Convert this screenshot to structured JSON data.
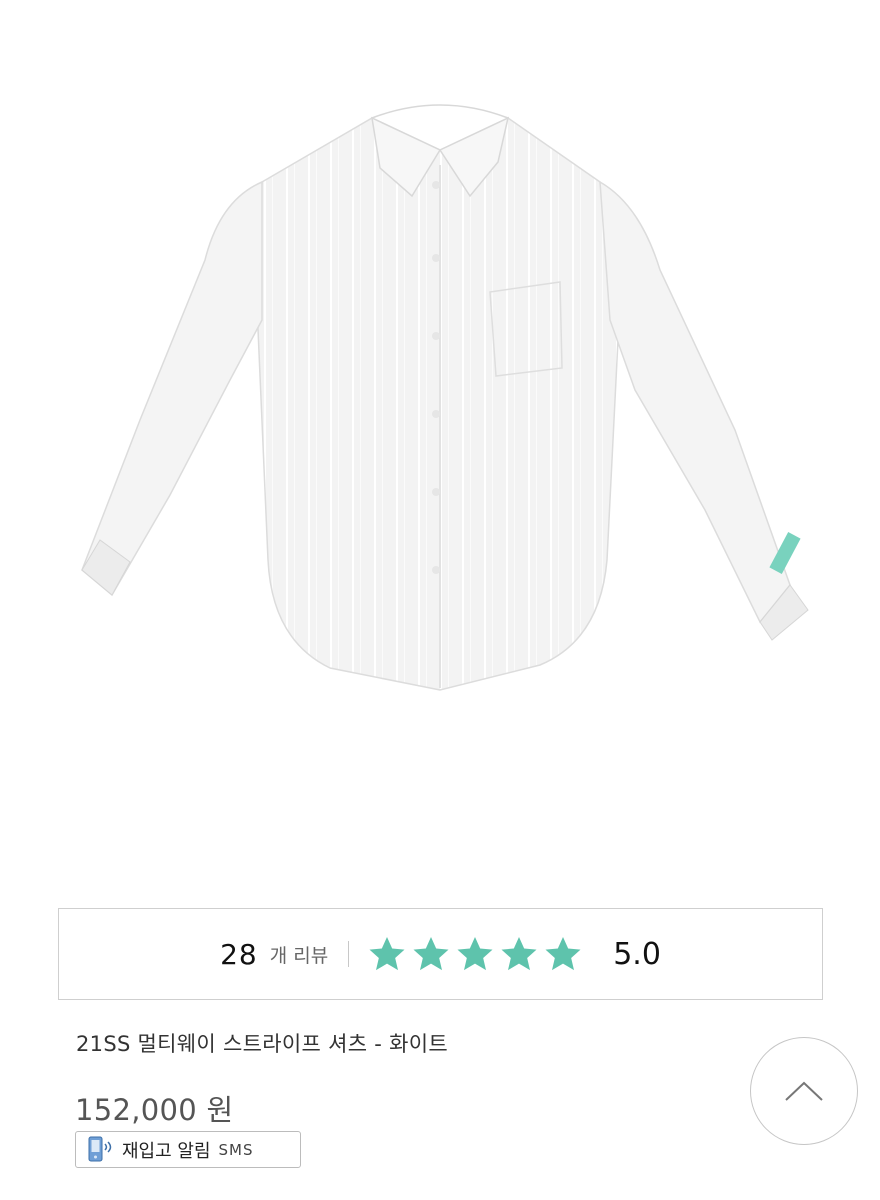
{
  "product": {
    "image_alt": "shirt",
    "cuff_tag_color": "#79d2be",
    "name": "21SS 멀티웨이 스트라이프 셔츠 - 화이트",
    "price": "152,000 원"
  },
  "reviews": {
    "count": "28",
    "unit_label": "개 리뷰",
    "rating": "5.0",
    "stars_filled": 5,
    "stars_total": 5,
    "star_color": "#5ec3ac"
  },
  "restock": {
    "icon": "phone-icon",
    "label": "재입고 알림",
    "sms": "SMS"
  },
  "scroll_top": {
    "icon": "chevron-up-icon"
  }
}
